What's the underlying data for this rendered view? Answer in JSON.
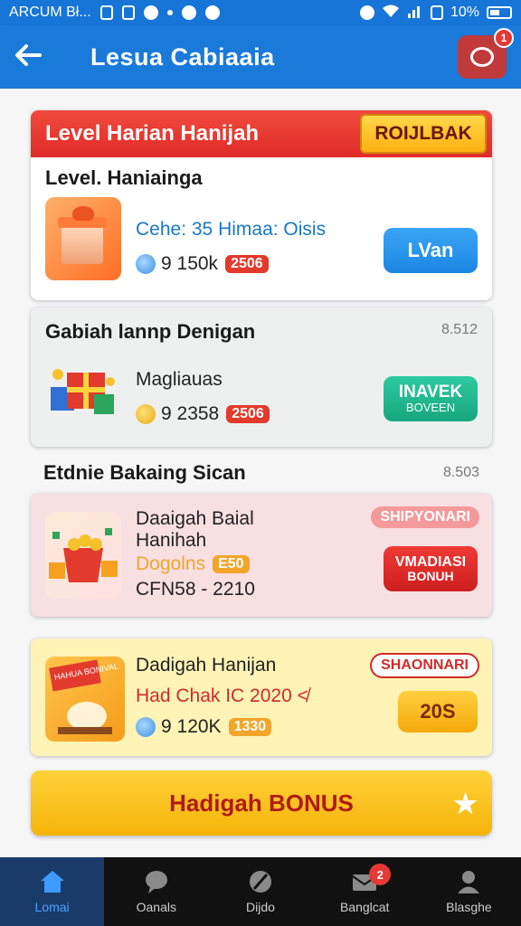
{
  "status_bar": {
    "carrier": "ARCUM Bł...",
    "battery": "10%"
  },
  "app_bar": {
    "title": "Lesua Cabiaaia",
    "chat_badge": "1"
  },
  "card1": {
    "header_title": "Level Harian Hanijah",
    "header_button": "ROIJLBAK",
    "subtitle": "Level. Haniainga",
    "item_name": "Cehe: 35 Himaa: Oisis",
    "price": "9 150k",
    "tag": "2506",
    "action": "LVan"
  },
  "card2": {
    "subtitle": "Gabiah lannp Denigan",
    "meta": "8.512",
    "item_name": "Magliauas",
    "price": "9 2358",
    "tag": "2506",
    "action": "INAVEK",
    "action_sub": "BOVEEN"
  },
  "section": {
    "title": "Etdnie Bakaing Sican",
    "meta": "8.503"
  },
  "card3": {
    "item_name_1": "Daaigah Baial",
    "item_name_2": "Hanihah",
    "orange_text": "Dogolns",
    "tag": "E50",
    "code": "CFN58 - 2210",
    "pill": "SHIPYONARI",
    "action": "VMADIASI",
    "action_sub": "BONUH"
  },
  "card4": {
    "item_name": "Dadigah Hanijan",
    "promo_text": "Had Chak IC 2020 ≮",
    "price": "9 120K",
    "tag": "1330",
    "pill": "SHAONNARI",
    "action": "20S",
    "thumb_text": "HAHUA BONIVAL"
  },
  "bonus_bar": {
    "label": "Hadigah BONUS"
  },
  "bottom_nav": [
    {
      "label": "Lomai"
    },
    {
      "label": "Oanals"
    },
    {
      "label": "Dijdo"
    },
    {
      "label": "Banglcat",
      "badge": "2"
    },
    {
      "label": "Blasghe"
    }
  ]
}
